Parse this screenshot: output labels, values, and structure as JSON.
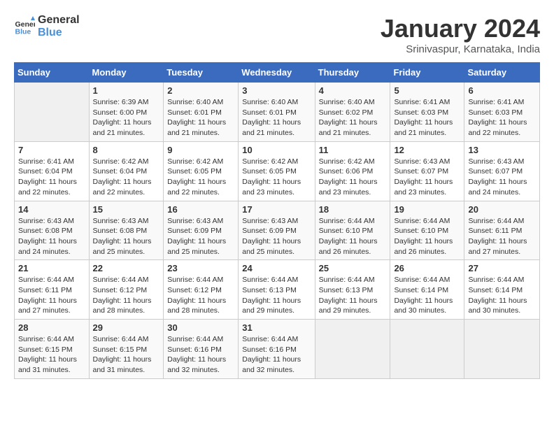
{
  "header": {
    "logo_general": "General",
    "logo_blue": "Blue",
    "month": "January 2024",
    "location": "Srinivaspur, Karnataka, India"
  },
  "weekdays": [
    "Sunday",
    "Monday",
    "Tuesday",
    "Wednesday",
    "Thursday",
    "Friday",
    "Saturday"
  ],
  "weeks": [
    [
      {
        "day": "",
        "sunrise": "",
        "sunset": "",
        "daylight": ""
      },
      {
        "day": "1",
        "sunrise": "Sunrise: 6:39 AM",
        "sunset": "Sunset: 6:00 PM",
        "daylight": "Daylight: 11 hours and 21 minutes."
      },
      {
        "day": "2",
        "sunrise": "Sunrise: 6:40 AM",
        "sunset": "Sunset: 6:01 PM",
        "daylight": "Daylight: 11 hours and 21 minutes."
      },
      {
        "day": "3",
        "sunrise": "Sunrise: 6:40 AM",
        "sunset": "Sunset: 6:01 PM",
        "daylight": "Daylight: 11 hours and 21 minutes."
      },
      {
        "day": "4",
        "sunrise": "Sunrise: 6:40 AM",
        "sunset": "Sunset: 6:02 PM",
        "daylight": "Daylight: 11 hours and 21 minutes."
      },
      {
        "day": "5",
        "sunrise": "Sunrise: 6:41 AM",
        "sunset": "Sunset: 6:03 PM",
        "daylight": "Daylight: 11 hours and 21 minutes."
      },
      {
        "day": "6",
        "sunrise": "Sunrise: 6:41 AM",
        "sunset": "Sunset: 6:03 PM",
        "daylight": "Daylight: 11 hours and 22 minutes."
      }
    ],
    [
      {
        "day": "7",
        "sunrise": "Sunrise: 6:41 AM",
        "sunset": "Sunset: 6:04 PM",
        "daylight": "Daylight: 11 hours and 22 minutes."
      },
      {
        "day": "8",
        "sunrise": "Sunrise: 6:42 AM",
        "sunset": "Sunset: 6:04 PM",
        "daylight": "Daylight: 11 hours and 22 minutes."
      },
      {
        "day": "9",
        "sunrise": "Sunrise: 6:42 AM",
        "sunset": "Sunset: 6:05 PM",
        "daylight": "Daylight: 11 hours and 22 minutes."
      },
      {
        "day": "10",
        "sunrise": "Sunrise: 6:42 AM",
        "sunset": "Sunset: 6:05 PM",
        "daylight": "Daylight: 11 hours and 23 minutes."
      },
      {
        "day": "11",
        "sunrise": "Sunrise: 6:42 AM",
        "sunset": "Sunset: 6:06 PM",
        "daylight": "Daylight: 11 hours and 23 minutes."
      },
      {
        "day": "12",
        "sunrise": "Sunrise: 6:43 AM",
        "sunset": "Sunset: 6:07 PM",
        "daylight": "Daylight: 11 hours and 23 minutes."
      },
      {
        "day": "13",
        "sunrise": "Sunrise: 6:43 AM",
        "sunset": "Sunset: 6:07 PM",
        "daylight": "Daylight: 11 hours and 24 minutes."
      }
    ],
    [
      {
        "day": "14",
        "sunrise": "Sunrise: 6:43 AM",
        "sunset": "Sunset: 6:08 PM",
        "daylight": "Daylight: 11 hours and 24 minutes."
      },
      {
        "day": "15",
        "sunrise": "Sunrise: 6:43 AM",
        "sunset": "Sunset: 6:08 PM",
        "daylight": "Daylight: 11 hours and 25 minutes."
      },
      {
        "day": "16",
        "sunrise": "Sunrise: 6:43 AM",
        "sunset": "Sunset: 6:09 PM",
        "daylight": "Daylight: 11 hours and 25 minutes."
      },
      {
        "day": "17",
        "sunrise": "Sunrise: 6:43 AM",
        "sunset": "Sunset: 6:09 PM",
        "daylight": "Daylight: 11 hours and 25 minutes."
      },
      {
        "day": "18",
        "sunrise": "Sunrise: 6:44 AM",
        "sunset": "Sunset: 6:10 PM",
        "daylight": "Daylight: 11 hours and 26 minutes."
      },
      {
        "day": "19",
        "sunrise": "Sunrise: 6:44 AM",
        "sunset": "Sunset: 6:10 PM",
        "daylight": "Daylight: 11 hours and 26 minutes."
      },
      {
        "day": "20",
        "sunrise": "Sunrise: 6:44 AM",
        "sunset": "Sunset: 6:11 PM",
        "daylight": "Daylight: 11 hours and 27 minutes."
      }
    ],
    [
      {
        "day": "21",
        "sunrise": "Sunrise: 6:44 AM",
        "sunset": "Sunset: 6:11 PM",
        "daylight": "Daylight: 11 hours and 27 minutes."
      },
      {
        "day": "22",
        "sunrise": "Sunrise: 6:44 AM",
        "sunset": "Sunset: 6:12 PM",
        "daylight": "Daylight: 11 hours and 28 minutes."
      },
      {
        "day": "23",
        "sunrise": "Sunrise: 6:44 AM",
        "sunset": "Sunset: 6:12 PM",
        "daylight": "Daylight: 11 hours and 28 minutes."
      },
      {
        "day": "24",
        "sunrise": "Sunrise: 6:44 AM",
        "sunset": "Sunset: 6:13 PM",
        "daylight": "Daylight: 11 hours and 29 minutes."
      },
      {
        "day": "25",
        "sunrise": "Sunrise: 6:44 AM",
        "sunset": "Sunset: 6:13 PM",
        "daylight": "Daylight: 11 hours and 29 minutes."
      },
      {
        "day": "26",
        "sunrise": "Sunrise: 6:44 AM",
        "sunset": "Sunset: 6:14 PM",
        "daylight": "Daylight: 11 hours and 30 minutes."
      },
      {
        "day": "27",
        "sunrise": "Sunrise: 6:44 AM",
        "sunset": "Sunset: 6:14 PM",
        "daylight": "Daylight: 11 hours and 30 minutes."
      }
    ],
    [
      {
        "day": "28",
        "sunrise": "Sunrise: 6:44 AM",
        "sunset": "Sunset: 6:15 PM",
        "daylight": "Daylight: 11 hours and 31 minutes."
      },
      {
        "day": "29",
        "sunrise": "Sunrise: 6:44 AM",
        "sunset": "Sunset: 6:15 PM",
        "daylight": "Daylight: 11 hours and 31 minutes."
      },
      {
        "day": "30",
        "sunrise": "Sunrise: 6:44 AM",
        "sunset": "Sunset: 6:16 PM",
        "daylight": "Daylight: 11 hours and 32 minutes."
      },
      {
        "day": "31",
        "sunrise": "Sunrise: 6:44 AM",
        "sunset": "Sunset: 6:16 PM",
        "daylight": "Daylight: 11 hours and 32 minutes."
      },
      {
        "day": "",
        "sunrise": "",
        "sunset": "",
        "daylight": ""
      },
      {
        "day": "",
        "sunrise": "",
        "sunset": "",
        "daylight": ""
      },
      {
        "day": "",
        "sunrise": "",
        "sunset": "",
        "daylight": ""
      }
    ]
  ]
}
